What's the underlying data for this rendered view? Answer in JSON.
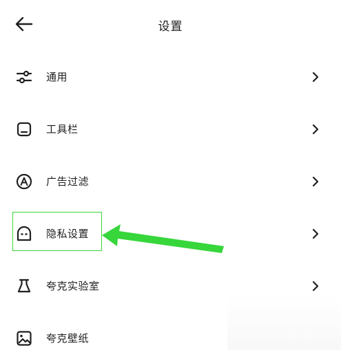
{
  "header": {
    "title": "设置",
    "back_icon": "arrow-left-icon"
  },
  "menu": {
    "items": [
      {
        "label": "通用",
        "icon": "sliders-icon"
      },
      {
        "label": "工具栏",
        "icon": "toolbar-icon"
      },
      {
        "label": "广告过滤",
        "icon": "ad-filter-icon"
      },
      {
        "label": "隐私设置",
        "icon": "privacy-icon"
      },
      {
        "label": "夸克实验室",
        "icon": "flask-icon"
      },
      {
        "label": "夸克壁纸",
        "icon": "wallpaper-icon"
      }
    ],
    "chevron_icon": "chevron-right-icon"
  },
  "annotation": {
    "highlight_color": "#37d63b",
    "arrow_color": "#37d63b",
    "highlighted_item": "隐私设置"
  }
}
